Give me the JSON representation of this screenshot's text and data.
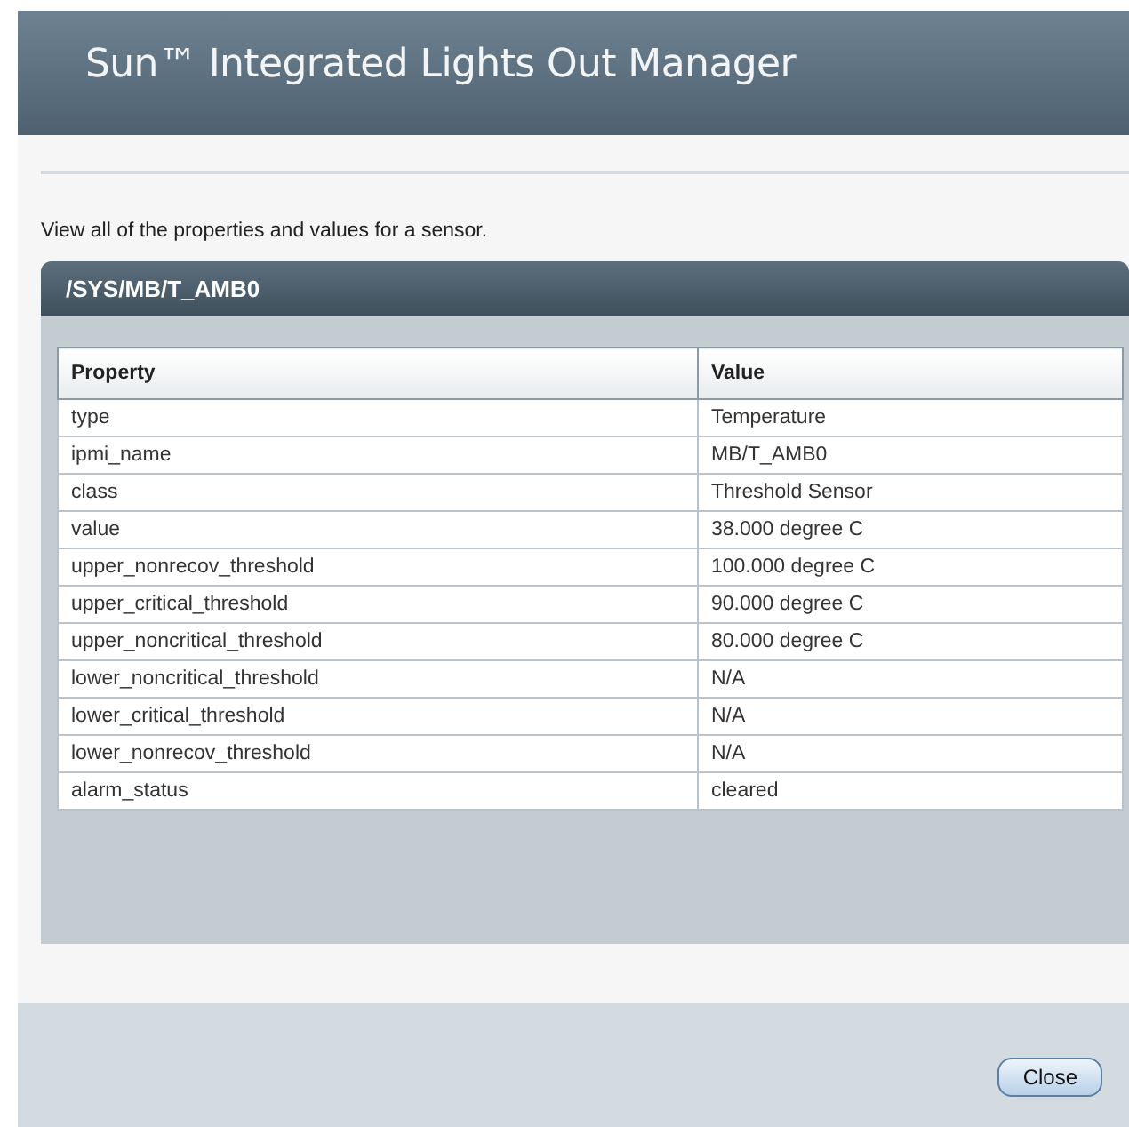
{
  "header": {
    "title": "Sun™ Integrated Lights Out Manager"
  },
  "intro": "View all of the properties and values for a sensor.",
  "panel": {
    "title": "/SYS/MB/T_AMB0",
    "table": {
      "columns": [
        "Property",
        "Value"
      ],
      "rows": [
        [
          "type",
          "Temperature"
        ],
        [
          "ipmi_name",
          "MB/T_AMB0"
        ],
        [
          "class",
          "Threshold Sensor"
        ],
        [
          "value",
          "38.000 degree C"
        ],
        [
          "upper_nonrecov_threshold",
          "100.000 degree C"
        ],
        [
          "upper_critical_threshold",
          "90.000 degree C"
        ],
        [
          "upper_noncritical_threshold",
          "80.000 degree C"
        ],
        [
          "lower_noncritical_threshold",
          "N/A"
        ],
        [
          "lower_critical_threshold",
          "N/A"
        ],
        [
          "lower_nonrecov_threshold",
          "N/A"
        ],
        [
          "alarm_status",
          "cleared"
        ]
      ]
    }
  },
  "buttons": [
    "Close"
  ]
}
